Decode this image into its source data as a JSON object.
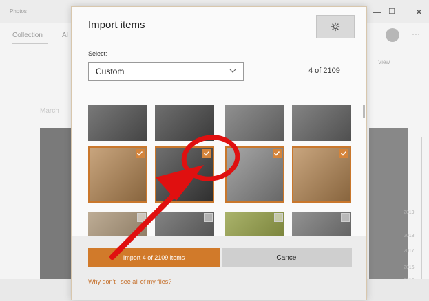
{
  "background_app": {
    "title": "Photos",
    "tab": "Collection",
    "tab_partial": "Al",
    "window_controls": {
      "minimize": "—",
      "maximize": "☐",
      "close": "✕"
    },
    "more": "···",
    "view_label": "View",
    "month_label": "March",
    "years": [
      "2019",
      "2018",
      "2017",
      "2016",
      "2015"
    ]
  },
  "dialog": {
    "title": "Import items",
    "settings_icon": "gear-icon",
    "select_label": "Select:",
    "select_value": "Custom",
    "count": "4 of 2109",
    "thumbnails": [
      {
        "selected": false,
        "tone": "#5b5b5b"
      },
      {
        "selected": false,
        "tone": "#4e4e4e"
      },
      {
        "selected": false,
        "tone": "#7a7a7a"
      },
      {
        "selected": false,
        "tone": "#6a6a6a"
      },
      {
        "selected": true,
        "tone": "#b68753"
      },
      {
        "selected": true,
        "tone": "#3f3f3f"
      },
      {
        "selected": true,
        "tone": "#8a8a8a"
      },
      {
        "selected": true,
        "tone": "#b68753"
      },
      {
        "selected": false,
        "tone": "#a89172"
      },
      {
        "selected": false,
        "tone": "#5a5a5a"
      },
      {
        "selected": false,
        "tone": "#8e9a3a"
      },
      {
        "selected": false,
        "tone": "#6e6e6e"
      }
    ],
    "import_button": "Import 4 of 2109 items",
    "cancel_button": "Cancel",
    "help_link": "Why don't I see all of my files?"
  },
  "annotation": {
    "color": "#e01010",
    "shape": "circle-and-arrow"
  },
  "colors": {
    "accent": "#d17a2a",
    "check": "#d4843b"
  }
}
